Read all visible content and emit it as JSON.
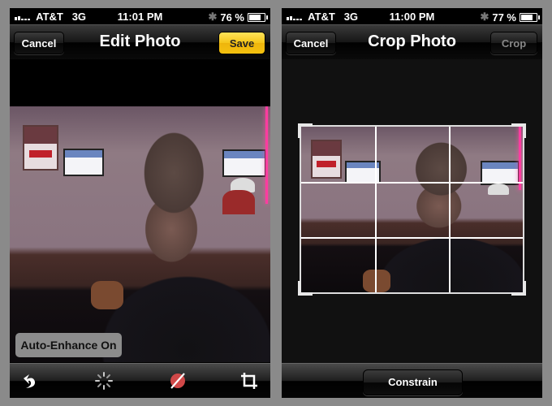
{
  "left_screen": {
    "status_bar": {
      "carrier": "AT&T",
      "network": "3G",
      "time": "11:01 PM",
      "battery_percent": "76 %",
      "battery_level": 0.76,
      "bluetooth_icon": "bluetooth-icon"
    },
    "nav_bar": {
      "title": "Edit Photo",
      "cancel_label": "Cancel",
      "save_label": "Save"
    },
    "photo_description": "Man with beard in dark t-shirt at a bar; TVs, Miller Lite poster, pink neon on wall",
    "auto_enhance_label": "Auto-Enhance On",
    "toolbar": [
      {
        "name": "rotate-icon",
        "label": "Rotate"
      },
      {
        "name": "enhance-icon",
        "label": "Enhance"
      },
      {
        "name": "red-eye-icon",
        "label": "Red-Eye"
      },
      {
        "name": "crop-icon",
        "label": "Crop"
      }
    ],
    "colors": {
      "save_button": "#f5c518",
      "red_eye_icon": "#d04848"
    }
  },
  "right_screen": {
    "status_bar": {
      "carrier": "AT&T",
      "network": "3G",
      "time": "11:00 PM",
      "battery_percent": "77 %",
      "battery_level": 0.77,
      "bluetooth_icon": "bluetooth-icon"
    },
    "nav_bar": {
      "title": "Crop Photo",
      "cancel_label": "Cancel",
      "crop_label": "Crop"
    },
    "crop_grid": {
      "rows": 3,
      "columns": 3
    },
    "constrain_label": "Constrain"
  }
}
